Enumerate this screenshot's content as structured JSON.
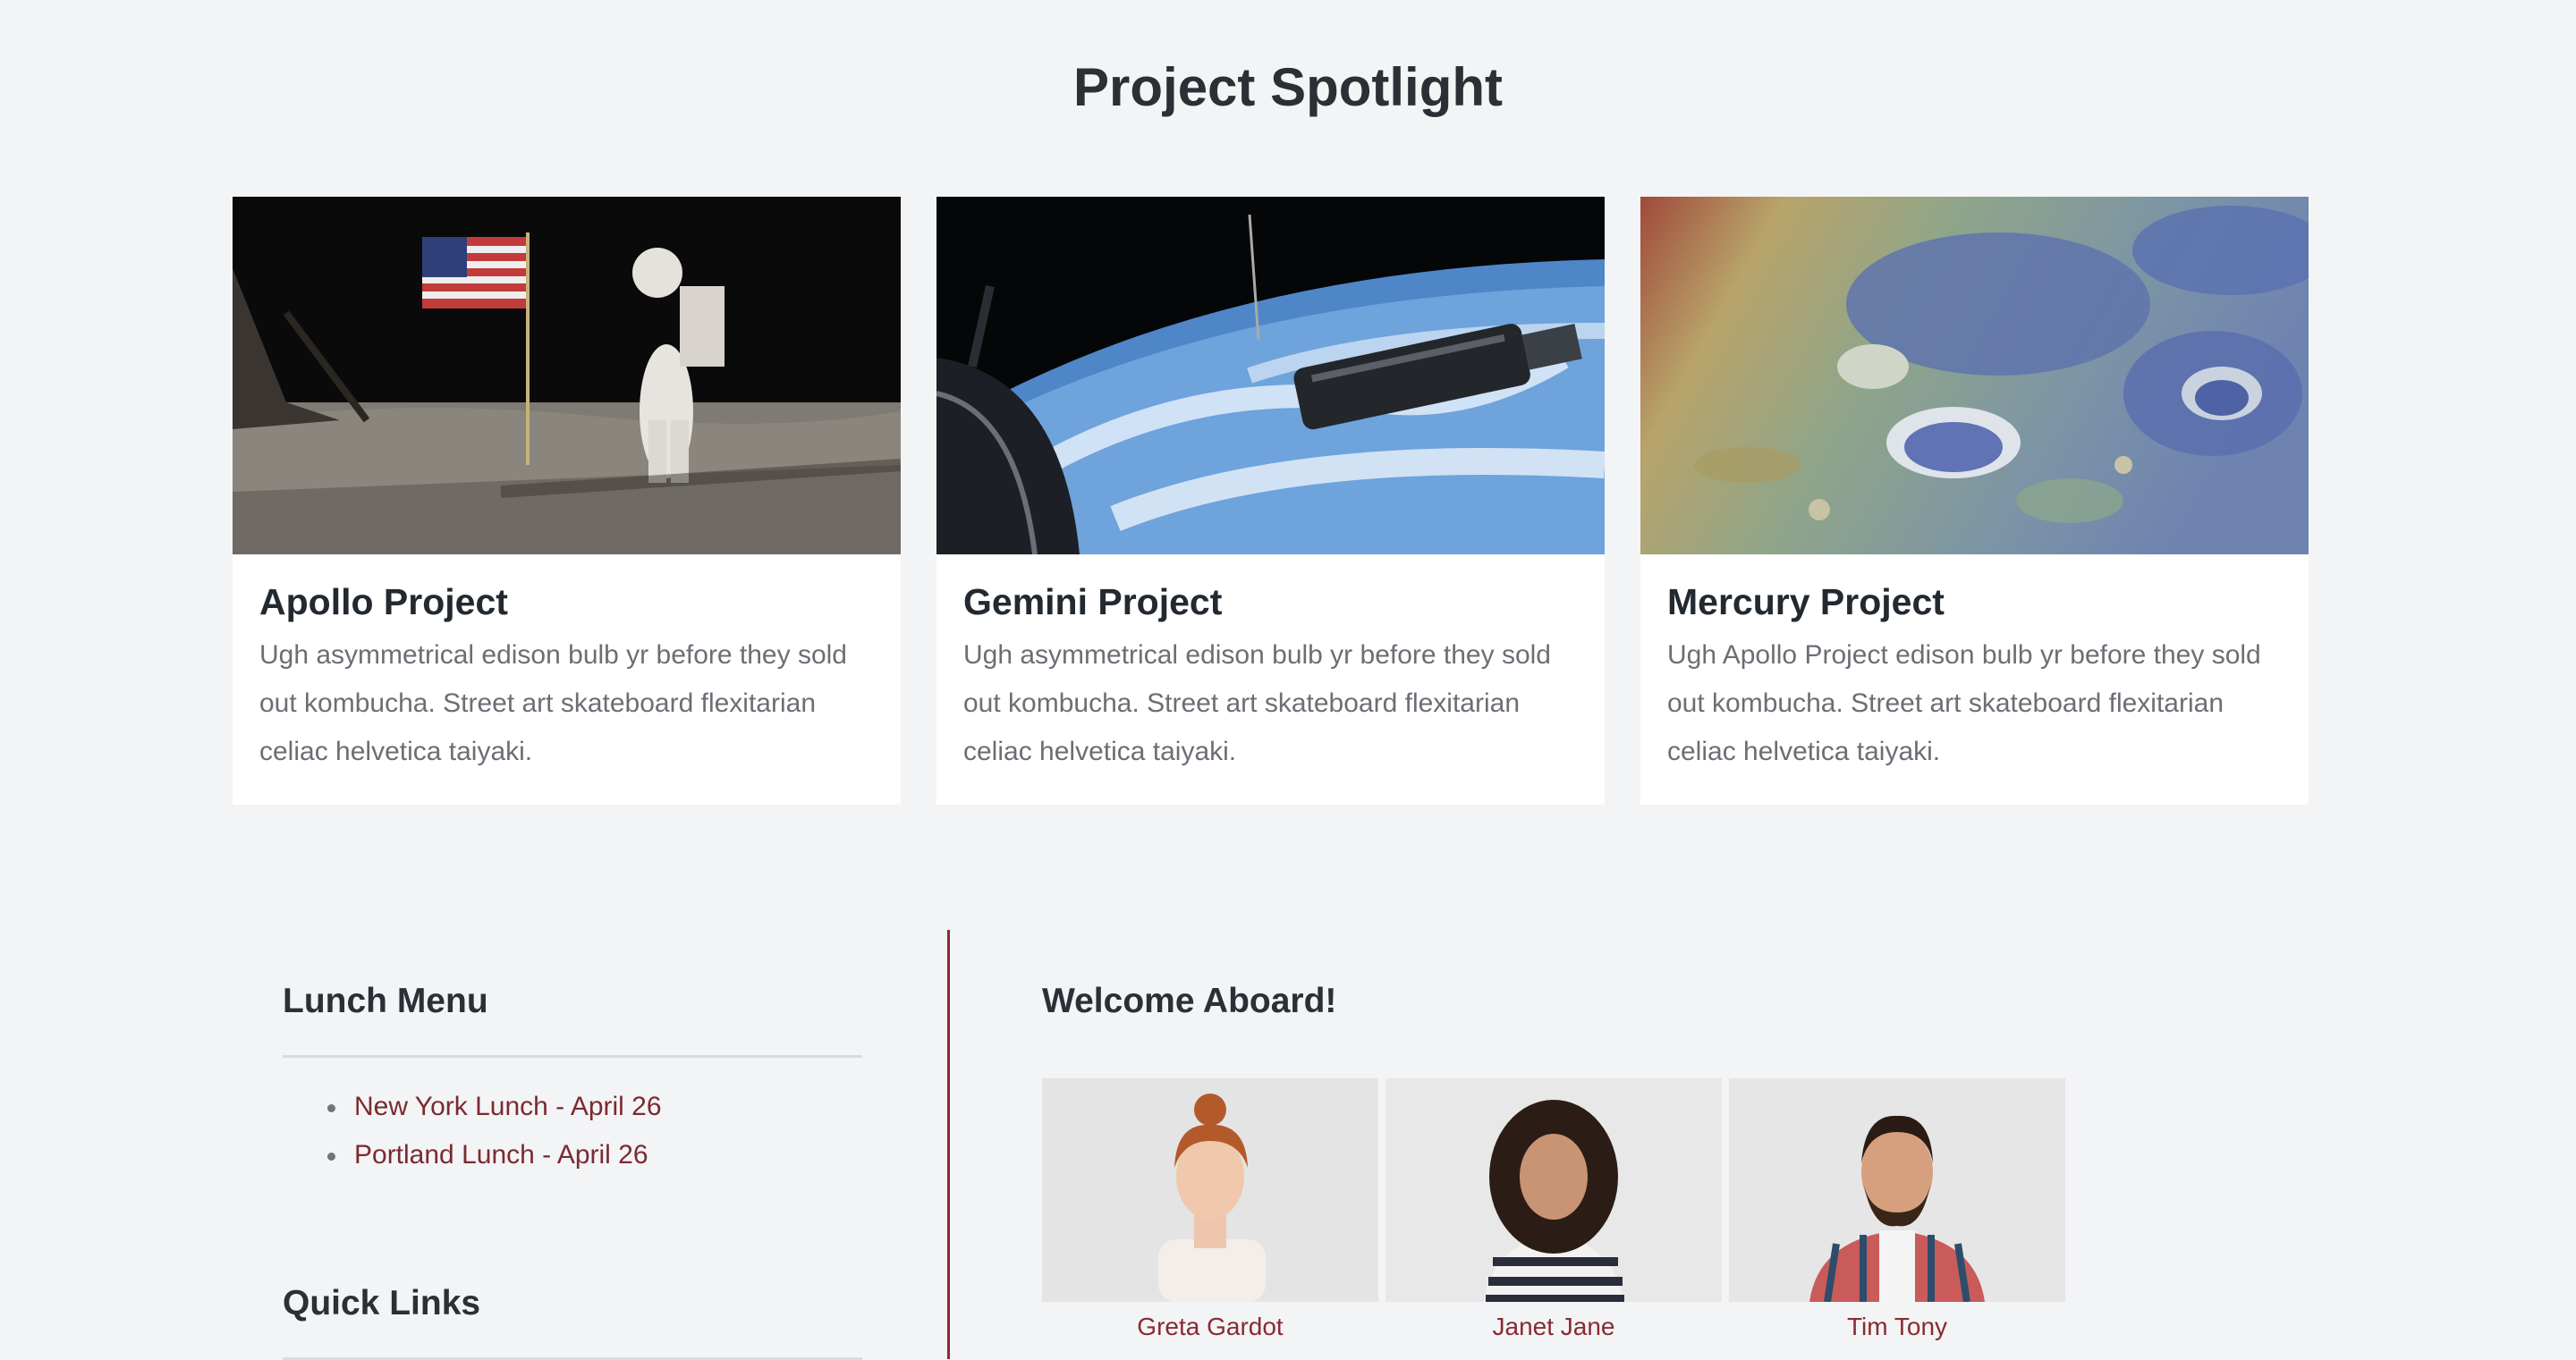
{
  "page": {
    "title": "Project Spotlight"
  },
  "projects": [
    {
      "title": "Apollo Project",
      "text": "Ugh asymmetrical edison bulb yr before they sold out kombucha. Street art skateboard flexitarian celiac helvetica taiyaki.",
      "image": "moon-landing-astronaut-flag"
    },
    {
      "title": "Gemini Project",
      "text": "Ugh asymmetrical edison bulb yr before they sold out kombucha. Street art skateboard flexitarian celiac helvetica taiyaki.",
      "image": "spacecraft-over-earth"
    },
    {
      "title": "Mercury Project",
      "text": "Ugh Apollo Project edison bulb yr before they sold out kombucha. Street art skateboard flexitarian celiac helvetica taiyaki.",
      "image": "mercury-surface-topography"
    }
  ],
  "lunch_menu": {
    "heading": "Lunch Menu",
    "items": [
      "New York Lunch - April 26",
      "Portland Lunch - April 26"
    ]
  },
  "quick_links": {
    "heading": "Quick Links"
  },
  "welcome": {
    "heading": "Welcome Aboard!",
    "people": [
      {
        "name": "Greta Gardot"
      },
      {
        "name": "Janet Jane"
      },
      {
        "name": "Tim Tony"
      }
    ]
  },
  "colors": {
    "background": "#f3f4f6",
    "accent": "#8a2a2f",
    "heading": "#262c33",
    "body_text": "#6a6f75"
  }
}
